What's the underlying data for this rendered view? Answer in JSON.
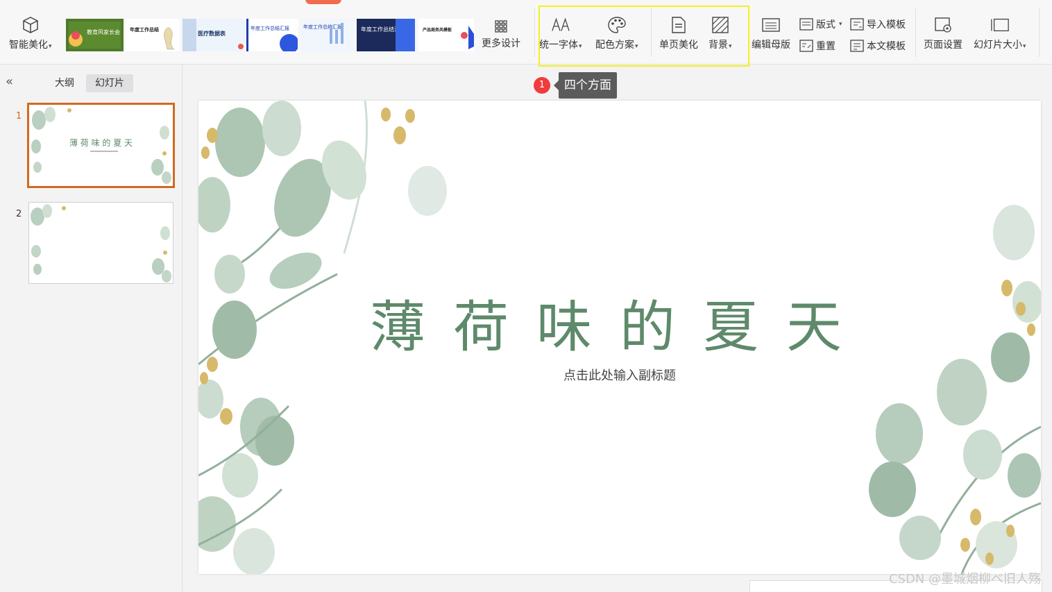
{
  "ribbon": {
    "smart_beautify": "智能美化",
    "more_design": "更多设计",
    "unify_font": "统一字体",
    "color_scheme": "配色方案",
    "single_page_beautify": "单页美化",
    "background": "背景",
    "edit_master": "编辑母版",
    "layout": "版式",
    "reset": "重置",
    "import_template": "导入模板",
    "this_template": "本文模板",
    "page_setup": "页面设置",
    "slide_size": "幻灯片大小"
  },
  "templates": [
    "教育风家长会",
    "年度工作总结",
    "医疗数据表",
    "年度工作总结汇报",
    "年度工作总结汇报",
    "年度工作总结汇报",
    "产品商务风模板"
  ],
  "left_pane": {
    "collapse": "«",
    "tab_outline": "大纲",
    "tab_slides": "幻灯片",
    "slides": [
      {
        "number": "1",
        "title": "薄 荷 味 的 夏 天"
      },
      {
        "number": "2",
        "title": ""
      }
    ]
  },
  "slide": {
    "title": "薄荷味的夏天",
    "subtitle": "点击此处输入副标题"
  },
  "tooltip": {
    "badge": "1",
    "text": "四个方面"
  },
  "watermark": "CSDN @墨城烟柳ベ旧人殇",
  "colors": {
    "accent": "#f26b4f",
    "title_green": "#5e8a6b",
    "highlight": "#f3f01e",
    "leaf": "#9fbca7",
    "gold": "#d6b96a"
  }
}
